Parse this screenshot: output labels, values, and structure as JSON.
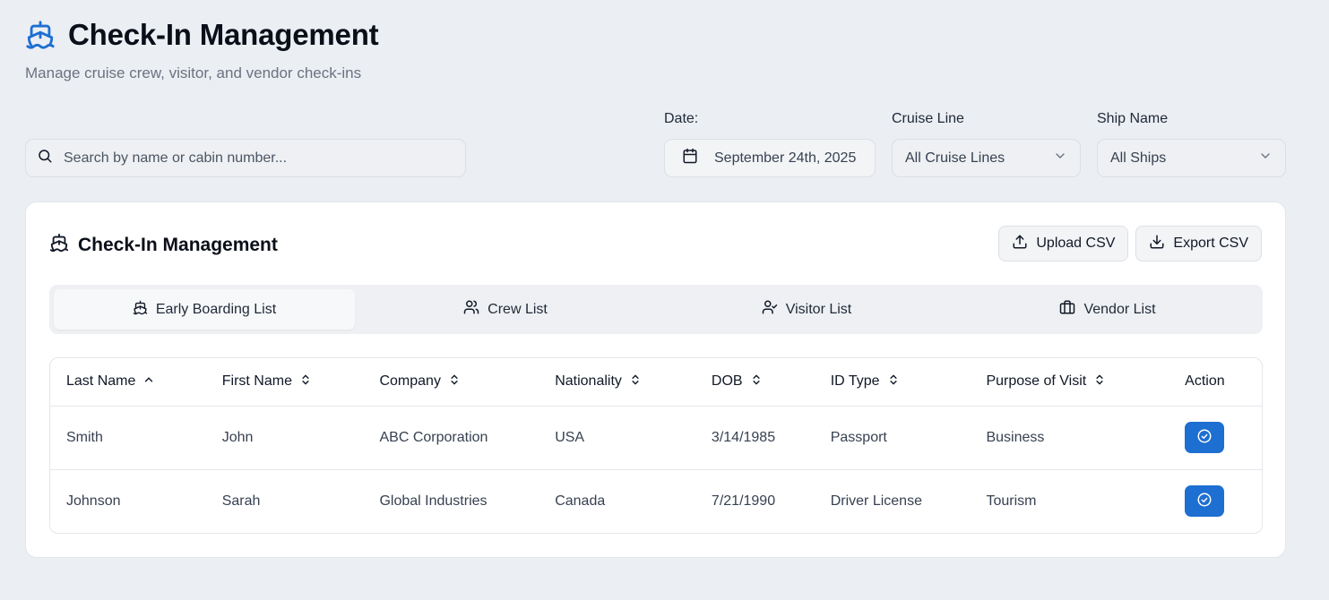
{
  "header": {
    "title": "Check-In Management",
    "subtitle": "Manage cruise crew, visitor, and vendor check-ins",
    "icon": "ship-icon",
    "accent": "#1d6fd1"
  },
  "search": {
    "placeholder": "Search by name or cabin number..."
  },
  "filters": {
    "date_label": "Date:",
    "date_value": "September 24th, 2025",
    "cruise_label": "Cruise Line",
    "cruise_value": "All Cruise Lines",
    "ship_label": "Ship Name",
    "ship_value": "All Ships"
  },
  "card": {
    "title": "Check-In Management",
    "upload_label": "Upload CSV",
    "export_label": "Export CSV"
  },
  "tabs": [
    {
      "label": "Early Boarding List",
      "icon": "ship-icon",
      "active": true
    },
    {
      "label": "Crew List",
      "icon": "users-icon",
      "active": false
    },
    {
      "label": "Visitor List",
      "icon": "user-check-icon",
      "active": false
    },
    {
      "label": "Vendor List",
      "icon": "briefcase-icon",
      "active": false
    }
  ],
  "table": {
    "columns": [
      "Last Name",
      "First Name",
      "Company",
      "Nationality",
      "DOB",
      "ID Type",
      "Purpose of Visit",
      "Action"
    ],
    "rows": [
      [
        "Smith",
        "John",
        "ABC Corporation",
        "USA",
        "3/14/1985",
        "Passport",
        "Business"
      ],
      [
        "Johnson",
        "Sarah",
        "Global Industries",
        "Canada",
        "7/21/1990",
        "Driver License",
        "Tourism"
      ]
    ]
  }
}
